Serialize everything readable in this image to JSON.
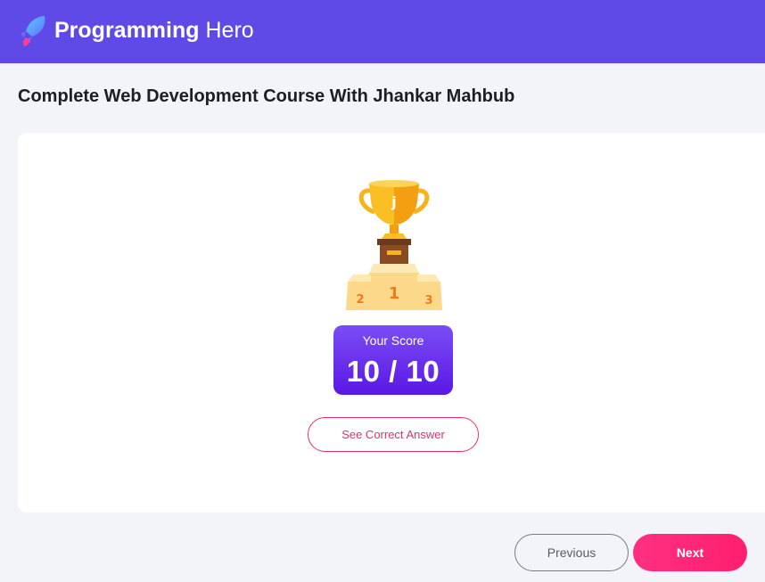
{
  "header": {
    "brand_primary": "Programming",
    "brand_secondary": "Hero",
    "logo_icon": "rocket-logo-icon",
    "background_color": "#5f4ae8"
  },
  "course": {
    "title": "Complete Web Development Course With Jhankar Mahbub"
  },
  "result": {
    "trophy_icon": "trophy-podium-icon",
    "score_label": "Your Score",
    "score_value": "10 / 10",
    "see_answer_label": "See Correct Answer"
  },
  "navigation": {
    "previous_label": "Previous",
    "next_label": "Next",
    "accent_color": "#ff2f82",
    "score_color": "#5a17e6"
  }
}
